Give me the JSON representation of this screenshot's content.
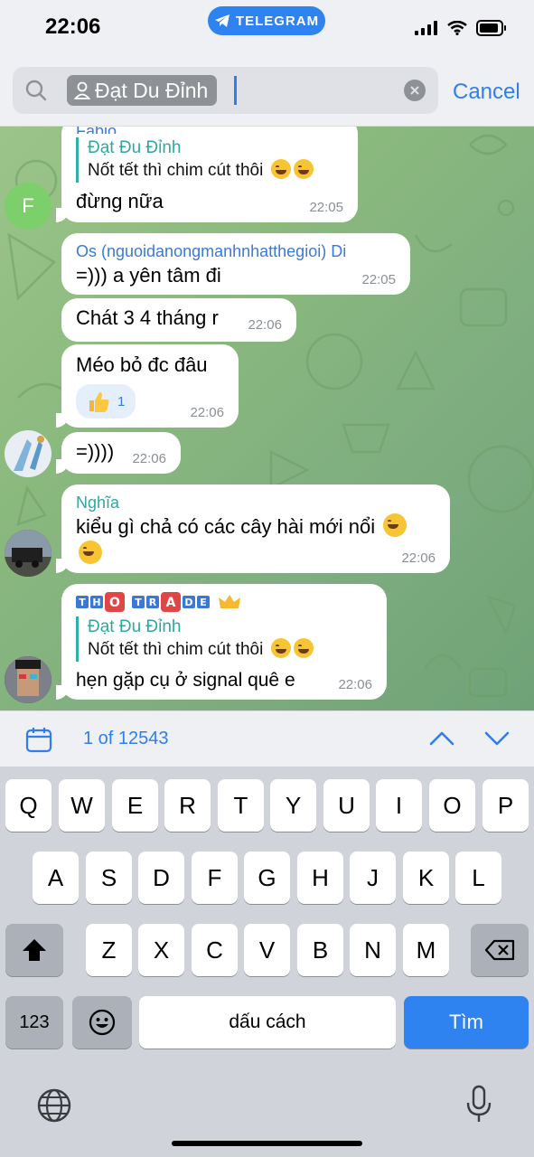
{
  "status_bar": {
    "time": "22:06",
    "app_pill": "TELEGRAM"
  },
  "search": {
    "token_label": "Đạt Du Đỉnh",
    "cancel_label": "Cancel"
  },
  "messages": [
    {
      "sender": "Fabio",
      "reply_name": "Đạt Đu Đỉnh",
      "reply_text": "Nốt tết thì chim cút thôi",
      "text": "đừng nữa",
      "time": "22:05",
      "avatar_letter": "F"
    },
    {
      "sender": "Os (nguoidanongmanhnhatthegioi) Di",
      "text": "=)))  a yên tâm đi",
      "time": "22:05"
    },
    {
      "text": "Chát 3 4 tháng r",
      "time": "22:06"
    },
    {
      "text": "Méo bỏ đc đâu",
      "time": "22:06",
      "reaction_count": "1"
    },
    {
      "text": "=))))",
      "time": "22:06"
    },
    {
      "sender": "Nghĩa",
      "text_line1": "kiểu gì chả có các cây hài mới nổi",
      "time": "22:06"
    },
    {
      "sender": "THO TRADE",
      "reply_name": "Đạt Đu Đỉnh",
      "reply_text": "Nốt tết thì chim cút thôi",
      "text": "hẹn gặp cụ ở signal quê e",
      "time": "22:06"
    }
  ],
  "results_nav": {
    "count": "1 of 12543"
  },
  "keyboard": {
    "row1": [
      "Q",
      "W",
      "E",
      "R",
      "T",
      "Y",
      "U",
      "I",
      "O",
      "P"
    ],
    "row2": [
      "A",
      "S",
      "D",
      "F",
      "G",
      "H",
      "J",
      "K",
      "L"
    ],
    "row3": [
      "Z",
      "X",
      "C",
      "V",
      "B",
      "N",
      "M"
    ],
    "numbers_label": "123",
    "space_label": "dấu cách",
    "search_label": "Tìm"
  },
  "colors": {
    "accent": "#2f7ef0",
    "chat_bg": "#8ab97e",
    "reply_bar": "#2fb1a7"
  }
}
